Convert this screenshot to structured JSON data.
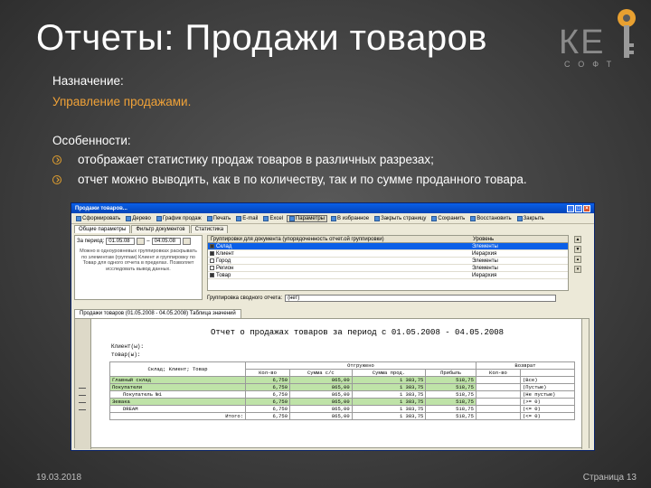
{
  "slide": {
    "title": "Отчеты: Продажи товаров",
    "purpose_label": "Назначение:",
    "purpose_value": "Управление продажами.",
    "features_label": "Особенности:",
    "features": [
      "отображает статистику продаж товаров в различных разрезах;",
      "отчет можно выводить, как в по количеству, так и по сумме проданного товара."
    ],
    "date": "19.03.2018",
    "page": "Страница 13",
    "logo_text": "КЕ",
    "logo_sub": "СОФТ",
    "colors": {
      "accent": "#f0a238",
      "background": "#404040"
    }
  },
  "window": {
    "title": "Продажи товаров...",
    "toolbar": [
      "Сформировать",
      "Дерево",
      "График продаж",
      "Печать",
      "E-mail",
      "Excel",
      "Параметры",
      "В избранное",
      "Закрыть страницу",
      "Сохранить",
      "Восстановить",
      "Закрыть"
    ],
    "tabs": [
      "Общие параметры",
      "Фильтр документов",
      "Статистика"
    ],
    "period_label": "За период:",
    "date_from": "01.05.08",
    "date_to": "04.05.08",
    "help_text": "Можно в одноуровневых группировках раскрывать по элементам (группам) Клиент и группировку по Товар для одного отчета в пределах. Позволяет исследовать вывод данных.",
    "grid_headers": [
      "Группировки для документа (упорядоченность отчет.ой группировки)",
      "Уровень"
    ],
    "grid_rows": [
      {
        "name": "Склад",
        "level": "Элементы",
        "checked": true,
        "selected": true
      },
      {
        "name": "Клиент",
        "level": "Иерархия",
        "checked": true,
        "selected": false
      },
      {
        "name": "Город",
        "level": "Элементы",
        "checked": false,
        "selected": false
      },
      {
        "name": "Регион",
        "level": "Элементы",
        "checked": false,
        "selected": false
      },
      {
        "name": "Товар",
        "level": "Иерархия",
        "checked": true,
        "selected": false
      }
    ],
    "groupby_label": "Группировка сводного отчета:",
    "groupby_value": "(нет)",
    "report_tab": "Продажи товаров (01.05.2008 - 04.05.2008) Таблица значений",
    "report_title": "Отчет о продажах товаров за период с 01.05.2008 - 04.05.2008",
    "client_label": "Клиент(ы):",
    "goods_label": "товар(ы):",
    "columns": {
      "name": "Склад; Клиент; Товар",
      "shipped": "Отгружено",
      "returned": "Возврат",
      "qty": "Кол-во",
      "cost": "Сумма с/с",
      "sales": "Сумма прод.",
      "profit": "Прибыль",
      "rqty": "Кол-во"
    },
    "rows": [
      {
        "name": "Главный склад",
        "qty": "6,750",
        "cost": "865,00",
        "sales": "1 383,75",
        "profit": "518,75",
        "filter": "(Все)",
        "group": true
      },
      {
        "name": "Покупатели",
        "qty": "6,750",
        "cost": "865,00",
        "sales": "1 383,75",
        "profit": "518,75",
        "filter": "(Пустые)",
        "group": true
      },
      {
        "name": "Покупатель №1",
        "qty": "6,750",
        "cost": "865,00",
        "sales": "1 383,75",
        "profit": "518,75",
        "filter": "(Не пустые)",
        "group": false
      },
      {
        "name": "Зевака",
        "qty": "6,750",
        "cost": "865,00",
        "sales": "1 383,75",
        "profit": "518,75",
        "filter": "(>= 0)",
        "group": true
      },
      {
        "name": "DREAM",
        "qty": "6,750",
        "cost": "865,00",
        "sales": "1 383,75",
        "profit": "518,75",
        "filter": "(<= 0)",
        "group": false
      }
    ],
    "total": {
      "label": "Итого:",
      "qty": "6,750",
      "cost": "865,00",
      "sales": "1 383,75",
      "profit": "518,75",
      "filter": "(<= 0)"
    }
  }
}
